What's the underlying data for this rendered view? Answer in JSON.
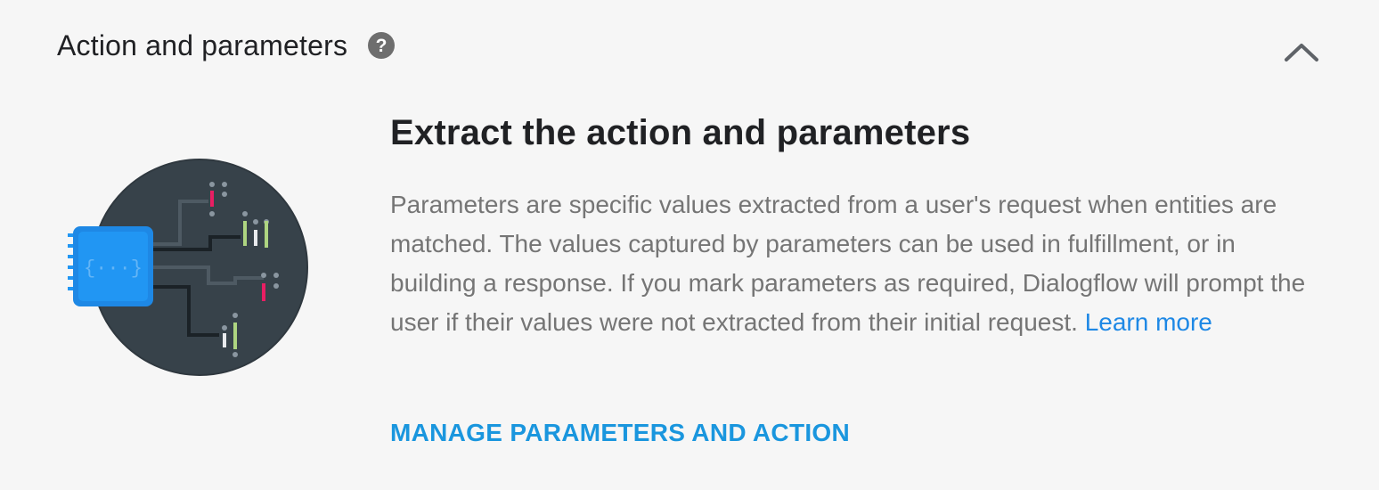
{
  "section": {
    "title": "Action and parameters",
    "help_icon": "help-circle-icon",
    "collapse_icon": "chevron-up-icon"
  },
  "content": {
    "title": "Extract the action and parameters",
    "description": "Parameters are specific values extracted from a user's request when entities are matched. The values captured by parameters can be used in fulfillment, or in building a response. If you mark parameters as required, Dialogflow will prompt the user if their values were not extracted from their initial request.",
    "learn_more": "Learn more",
    "manage_button": "MANAGE PARAMETERS AND ACTION"
  },
  "colors": {
    "text_primary": "#202124",
    "text_secondary": "#757575",
    "link": "#1e88e5",
    "button": "#1a96de",
    "illustration_bg": "#37424a",
    "chip": "#2196f3"
  }
}
